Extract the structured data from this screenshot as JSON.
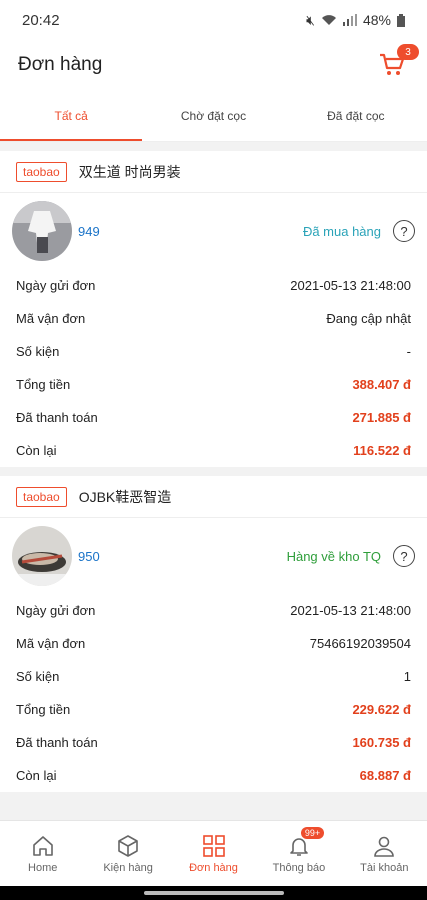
{
  "status_bar": {
    "time": "20:42",
    "battery": "48%"
  },
  "header": {
    "title": "Đơn hàng",
    "cart_count": "3"
  },
  "tabs": [
    {
      "label": "Tất cả",
      "active": true
    },
    {
      "label": "Chờ đặt cọc",
      "active": false
    },
    {
      "label": "Đã đặt cọc",
      "active": false
    }
  ],
  "orders": [
    {
      "source": "taobao",
      "shop": "双生道 时尚男装",
      "id": "949",
      "status": "Đã mua hàng",
      "status_color": "#2aa3b8",
      "rows": [
        {
          "label": "Ngày gửi đơn",
          "value": "2021-05-13 21:48:00"
        },
        {
          "label": "Mã vận đơn",
          "value": "Đang cập nhật"
        },
        {
          "label": "Số kiện",
          "value": "-"
        },
        {
          "label": "Tổng tiền",
          "value": "388.407 đ"
        },
        {
          "label": "Đã thanh toán",
          "value": "271.885 đ"
        },
        {
          "label": "Còn lại",
          "value": "116.522 đ"
        }
      ]
    },
    {
      "source": "taobao",
      "shop": "OJBK鞋恶智造",
      "id": "950",
      "status": "Hàng về kho TQ",
      "status_color": "#2e9e3a",
      "rows": [
        {
          "label": "Ngày gửi đơn",
          "value": "2021-05-13 21:48:00"
        },
        {
          "label": "Mã vận đơn",
          "value": "75466192039504"
        },
        {
          "label": "Số kiện",
          "value": "1"
        },
        {
          "label": "Tổng tiền",
          "value": "229.622 đ"
        },
        {
          "label": "Đã thanh toán",
          "value": "160.735 đ"
        },
        {
          "label": "Còn lại",
          "value": "68.887 đ"
        }
      ]
    }
  ],
  "bottom_nav": [
    {
      "label": "Home",
      "icon": "home-icon"
    },
    {
      "label": "Kiện hàng",
      "icon": "package-icon"
    },
    {
      "label": "Đơn hàng",
      "icon": "grid-icon",
      "active": true
    },
    {
      "label": "Thông báo",
      "icon": "bell-icon",
      "badge": "99+"
    },
    {
      "label": "Tài khoản",
      "icon": "user-icon"
    }
  ],
  "colors": {
    "accent": "#ee4d2d",
    "link": "#1a73c8"
  }
}
